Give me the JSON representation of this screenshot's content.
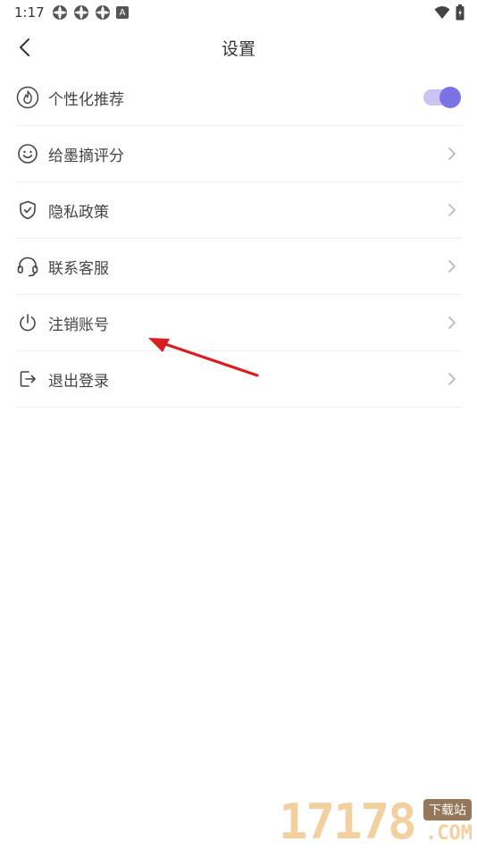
{
  "status_bar": {
    "time": "1:17",
    "badge_letter": "A"
  },
  "nav": {
    "title": "设置"
  },
  "settings": {
    "items": [
      {
        "label": "个性化推荐",
        "icon": "flame-icon",
        "control": "toggle",
        "toggle_on": true
      },
      {
        "label": "给墨摘评分",
        "icon": "smile-icon",
        "control": "chevron"
      },
      {
        "label": "隐私政策",
        "icon": "shield-check-icon",
        "control": "chevron"
      },
      {
        "label": "联系客服",
        "icon": "headset-icon",
        "control": "chevron"
      },
      {
        "label": "注销账号",
        "icon": "power-icon",
        "control": "chevron"
      },
      {
        "label": "退出登录",
        "icon": "logout-icon",
        "control": "chevron"
      }
    ]
  },
  "watermark": {
    "digits": "17178",
    "badge": "下载站",
    "suffix": ".COM"
  },
  "colors": {
    "accent": "#7b73e3",
    "accent_light": "#c9c4f2",
    "annotation_arrow": "#d81e1e",
    "divider": "#eeeeee"
  }
}
